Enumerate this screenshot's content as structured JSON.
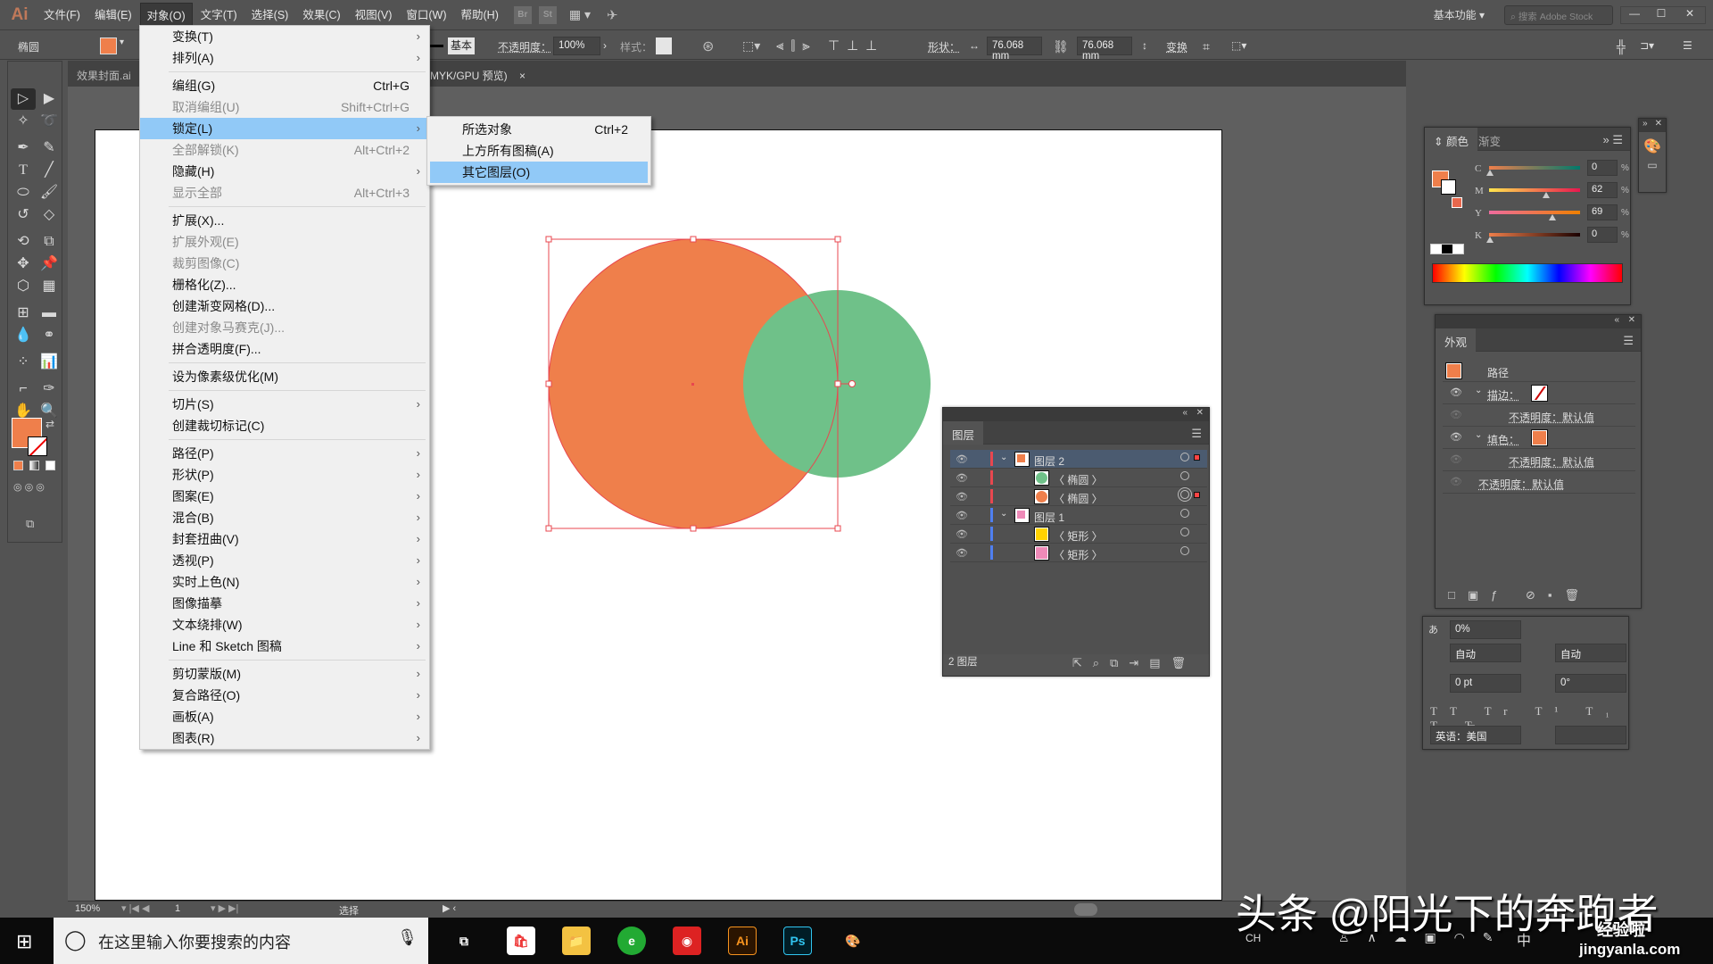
{
  "app": {
    "logo": "Ai",
    "workspace": "基本功能",
    "stock_search_placeholder": "搜索 Adobe Stock",
    "brand_color": "#c0795a"
  },
  "menubar": [
    "文件(F)",
    "编辑(E)",
    "对象(O)",
    "文字(T)",
    "选择(S)",
    "效果(C)",
    "视图(V)",
    "窗口(W)",
    "帮助(H)"
  ],
  "menubar_active": "对象(O)",
  "menubar_buttons": [
    "Br",
    "St"
  ],
  "control_bar": {
    "object_type": "椭圆",
    "fill_color": "#ef7f4b",
    "stroke_profile": "基本",
    "opacity_label": "不透明度：",
    "opacity_value": "100%",
    "style_label": "样式：",
    "shape_label": "形状：",
    "width_value": "76.068 mm",
    "height_value": "76.068 mm",
    "transform_label": "变换"
  },
  "tabs": [
    {
      "label": "效果封面.ai"
    },
    {
      "label": "MYK/GPU 预览)",
      "close": "×"
    }
  ],
  "object_menu": [
    {
      "label": "变换(T)",
      "submenu": true
    },
    {
      "label": "排列(A)",
      "submenu": true
    },
    {
      "sep": true
    },
    {
      "label": "编组(G)",
      "shortcut": "Ctrl+G"
    },
    {
      "label": "取消编组(U)",
      "shortcut": "Shift+Ctrl+G",
      "disabled": true
    },
    {
      "label": "锁定(L)",
      "submenu": true,
      "highlight": true
    },
    {
      "label": "全部解锁(K)",
      "shortcut": "Alt+Ctrl+2",
      "disabled": true
    },
    {
      "label": "隐藏(H)",
      "submenu": true
    },
    {
      "label": "显示全部",
      "shortcut": "Alt+Ctrl+3",
      "disabled": true
    },
    {
      "sep": true
    },
    {
      "label": "扩展(X)..."
    },
    {
      "label": "扩展外观(E)",
      "disabled": true
    },
    {
      "label": "裁剪图像(C)",
      "disabled": true
    },
    {
      "label": "栅格化(Z)..."
    },
    {
      "label": "创建渐变网格(D)..."
    },
    {
      "label": "创建对象马赛克(J)...",
      "disabled": true
    },
    {
      "label": "拼合透明度(F)..."
    },
    {
      "sep": true
    },
    {
      "label": "设为像素级优化(M)"
    },
    {
      "sep": true
    },
    {
      "label": "切片(S)",
      "submenu": true
    },
    {
      "label": "创建裁切标记(C)"
    },
    {
      "sep": true
    },
    {
      "label": "路径(P)",
      "submenu": true
    },
    {
      "label": "形状(P)",
      "submenu": true
    },
    {
      "label": "图案(E)",
      "submenu": true
    },
    {
      "label": "混合(B)",
      "submenu": true
    },
    {
      "label": "封套扭曲(V)",
      "submenu": true
    },
    {
      "label": "透视(P)",
      "submenu": true
    },
    {
      "label": "实时上色(N)",
      "submenu": true
    },
    {
      "label": "图像描摹",
      "submenu": true
    },
    {
      "label": "文本绕排(W)",
      "submenu": true
    },
    {
      "label": "Line 和 Sketch 图稿",
      "submenu": true
    },
    {
      "sep": true
    },
    {
      "label": "剪切蒙版(M)",
      "submenu": true
    },
    {
      "label": "复合路径(O)",
      "submenu": true
    },
    {
      "label": "画板(A)",
      "submenu": true
    },
    {
      "label": "图表(R)",
      "submenu": true
    }
  ],
  "lock_submenu": [
    {
      "label": "所选对象",
      "shortcut": "Ctrl+2"
    },
    {
      "label": "上方所有图稿(A)"
    },
    {
      "label": "其它图层(O)",
      "highlight": true
    }
  ],
  "canvas": {
    "orange_circle": "#ef7f4b",
    "green_circle": "#6fc189",
    "selection_color": "#e8474f"
  },
  "layers_panel": {
    "title": "图层",
    "footer": "2 图层",
    "rows": [
      {
        "name": "图层 2",
        "type": "layer",
        "color": "#e8474f",
        "selected": true
      },
      {
        "name": "〈 椭圆 〉",
        "type": "object",
        "color": "#e8474f",
        "thumb": "#6fc189"
      },
      {
        "name": "〈 椭圆 〉",
        "type": "object",
        "color": "#e8474f",
        "thumb": "#ef7f4b",
        "targeted": true
      },
      {
        "name": "图层 1",
        "type": "layer",
        "color": "#4f7ff0"
      },
      {
        "name": "〈 矩形 〉",
        "type": "object",
        "color": "#4f7ff0",
        "thumb": "#ffd200"
      },
      {
        "name": "〈 矩形 〉",
        "type": "object",
        "color": "#4f7ff0",
        "thumb": "#ee8ab8"
      }
    ]
  },
  "color_panel": {
    "tabs": [
      "颜色",
      "渐变"
    ],
    "channels": [
      {
        "name": "C",
        "value": "0",
        "unit": "%"
      },
      {
        "name": "M",
        "value": "62",
        "unit": "%"
      },
      {
        "name": "Y",
        "value": "69",
        "unit": "%"
      },
      {
        "name": "K",
        "value": "0",
        "unit": "%"
      }
    ]
  },
  "appearance_panel": {
    "title": "外观",
    "object": "路径",
    "rows": [
      {
        "label": "描边：",
        "kind": "stroke"
      },
      {
        "label": "不透明度：默认值",
        "indent": true
      },
      {
        "label": "填色：",
        "kind": "fill"
      },
      {
        "label": "不透明度：默认值",
        "indent": true
      },
      {
        "label": "不透明度：默认值"
      }
    ]
  },
  "char_panel": {
    "tracking": "0%",
    "auto1": "自动",
    "auto2": "自动",
    "baseline": "0 pt",
    "rotation": "0°",
    "language": "英语：美国"
  },
  "statusbar": {
    "zoom": "150%",
    "artboard": "1",
    "tool": "选择"
  },
  "taskbar": {
    "search_placeholder": "在这里输入你要搜索的内容",
    "ime": "CH",
    "lang": "中"
  },
  "watermark": {
    "text": "头条 @阳光下的奔跑者",
    "site1": "经验啦",
    "site2": "jingyanla.com"
  }
}
